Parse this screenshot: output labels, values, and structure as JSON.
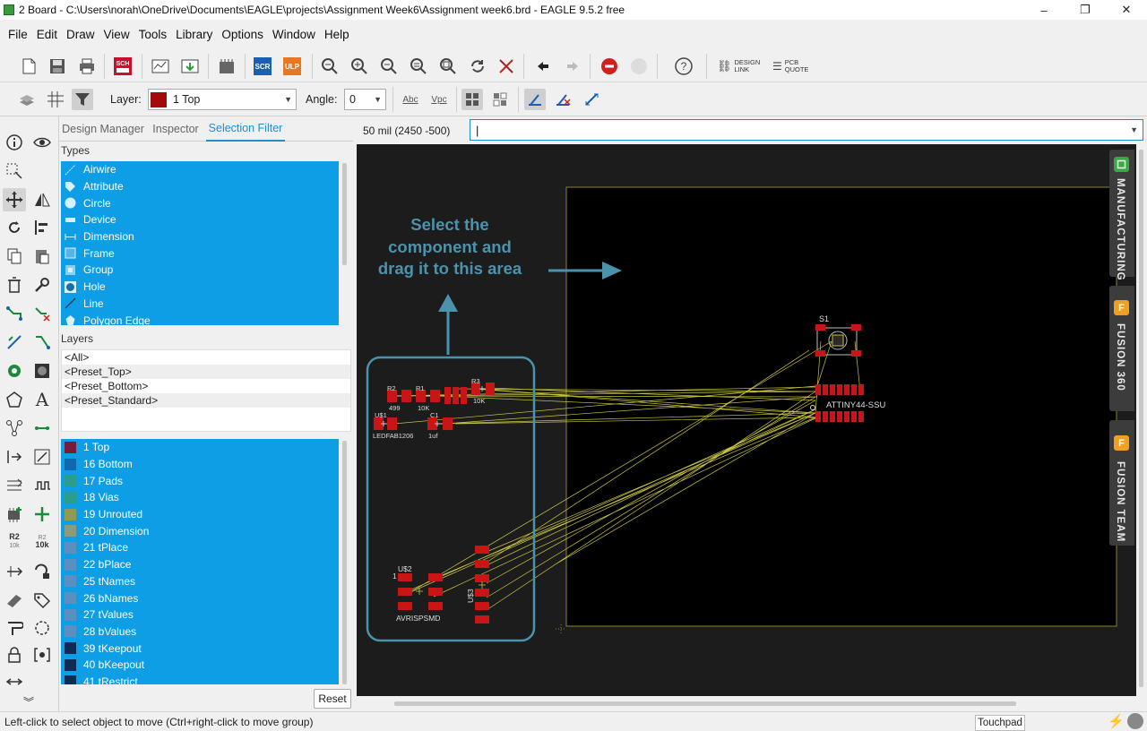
{
  "window": {
    "title": "2 Board - C:\\Users\\norah\\OneDrive\\Documents\\EAGLE\\projects\\Assignment Week6\\Assignment week6.brd - EAGLE 9.5.2 free",
    "controls": [
      "–",
      "❐",
      "✕"
    ]
  },
  "menu": [
    "File",
    "Edit",
    "Draw",
    "View",
    "Tools",
    "Library",
    "Options",
    "Window",
    "Help"
  ],
  "toolbar": {
    "scr_label": "SCR",
    "ulp_label": "ULP",
    "help_label": "?",
    "design_link": "DESIGN LINK",
    "pcb_quote": "PCB QUOTE"
  },
  "toolbar2": {
    "layer_label": "Layer:",
    "layer_value": "1 Top",
    "layer_color": "#a30a0a",
    "angle_label": "Angle:",
    "angle_value": "0",
    "abc_label": "Abc",
    "vpc_label": "Vpc"
  },
  "panel": {
    "tabs": [
      "Design Manager",
      "Inspector",
      "Selection Filter"
    ],
    "active_tab": "Selection Filter",
    "types_header": "Types",
    "types": [
      {
        "label": "Airwire",
        "icon": "airwire-icon"
      },
      {
        "label": "Attribute",
        "icon": "tag-icon"
      },
      {
        "label": "Circle",
        "icon": "circle-icon"
      },
      {
        "label": "Device",
        "icon": "device-icon"
      },
      {
        "label": "Dimension",
        "icon": "dimension-icon"
      },
      {
        "label": "Frame",
        "icon": "frame-icon"
      },
      {
        "label": "Group",
        "icon": "group-icon"
      },
      {
        "label": "Hole",
        "icon": "hole-icon"
      },
      {
        "label": "Line",
        "icon": "line-icon"
      },
      {
        "label": "Polygon Edge",
        "icon": "polygon-icon"
      }
    ],
    "layers_header": "Layers",
    "presets": [
      "<All>",
      "<Preset_Top>",
      "<Preset_Bottom>",
      "<Preset_Standard>"
    ],
    "layers": [
      {
        "label": "1 Top",
        "color": "#7a1b3c"
      },
      {
        "label": "16 Bottom",
        "color": "#1068b0"
      },
      {
        "label": "17 Pads",
        "color": "#2a9e8a"
      },
      {
        "label": "18 Vias",
        "color": "#2a9e8a"
      },
      {
        "label": "19 Unrouted",
        "color": "#8f9a55"
      },
      {
        "label": "20 Dimension",
        "color": "#8f9a78"
      },
      {
        "label": "21 tPlace",
        "color": "#5b8fc0"
      },
      {
        "label": "22 bPlace",
        "color": "#5b8fc0"
      },
      {
        "label": "25 tNames",
        "color": "#5b8fc0"
      },
      {
        "label": "26 bNames",
        "color": "#5b8fc0"
      },
      {
        "label": "27 tValues",
        "color": "#5b8fc0"
      },
      {
        "label": "28 bValues",
        "color": "#5b8fc0"
      },
      {
        "label": "39 tKeepout",
        "color": "#0d2c55"
      },
      {
        "label": "40 bKeepout",
        "color": "#0d2c55"
      },
      {
        "label": "41 tRestrict",
        "color": "#0d2c55"
      }
    ],
    "reset_label": "Reset"
  },
  "coords": "50 mil (2450 -500)",
  "command_value": "",
  "canvas": {
    "annotation_lines": [
      "Select the",
      "component and",
      "drag it to this area"
    ],
    "labels": {
      "s1": "S1",
      "r2": "R2",
      "r1": "R1",
      "r3": "R3",
      "v499": "499",
      "v10k": "10K",
      "v10k_b": "10K",
      "us1": "U$1",
      "c1": "C1",
      "ledfab": "LEDFAB1206",
      "c_val": "1uf",
      "attiny": "ATTINY44-SSU",
      "us2": "U$2",
      "us2_num": "1",
      "avrisp": "AVRISPSMD",
      "us3": "U$3"
    }
  },
  "side_tabs": [
    {
      "label": "MANUFACTURING",
      "badge": "",
      "badge_color": "#3aa845"
    },
    {
      "label": "FUSION 360",
      "badge": "F",
      "badge_color": "#f0a020"
    },
    {
      "label": "FUSION TEAM",
      "badge": "F",
      "badge_color": "#f0a020"
    }
  ],
  "status": {
    "text": "Left-click to select object to move (Ctrl+right-click to move group)",
    "touchpad": "Touchpad"
  }
}
